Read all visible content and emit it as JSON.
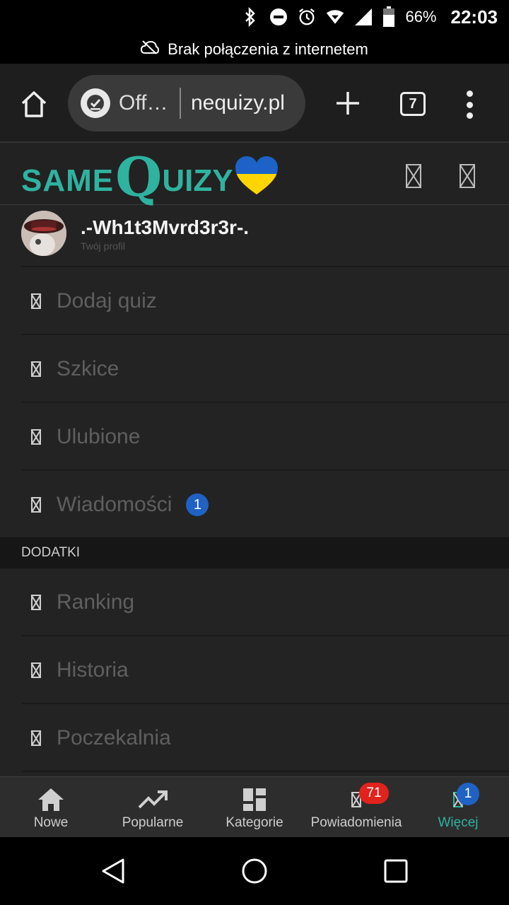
{
  "status_bar": {
    "battery_percent": "66%",
    "time": "22:03",
    "icons": [
      "bluetooth-icon",
      "do-not-disturb-icon",
      "alarm-icon",
      "wifi-icon",
      "cellular-signal-icon",
      "battery-icon"
    ]
  },
  "offline_banner": {
    "text": "Brak połączenia z internetem",
    "icon": "cloud-off-icon"
  },
  "browser": {
    "omnibox_status": "Off…",
    "url": "nequizy.pl",
    "tab_count": "7",
    "icons": [
      "home-icon",
      "offline-check-icon",
      "new-tab-plus-icon",
      "tabs-icon",
      "more-vert-icon"
    ]
  },
  "site": {
    "logo": {
      "same": "SAME",
      "q": "Q",
      "uizy": "UIZY"
    },
    "accent_color": "#2fb3a0"
  },
  "profile": {
    "name": ".-Wh1t3Mvrd3r3r-.",
    "subtitle": "Twój profil"
  },
  "menu": {
    "items": [
      {
        "label": "Dodaj quiz"
      },
      {
        "label": "Szkice"
      },
      {
        "label": "Ulubione"
      },
      {
        "label": "Wiadomości",
        "badge": "1"
      }
    ],
    "section_title": "DODATKI",
    "extra_items": [
      {
        "label": "Ranking"
      },
      {
        "label": "Historia"
      },
      {
        "label": "Poczekalnia"
      }
    ]
  },
  "bottom_nav": {
    "items": [
      {
        "label": "Nowe",
        "icon": "home-icon"
      },
      {
        "label": "Popularne",
        "icon": "trending-up-icon"
      },
      {
        "label": "Kategorie",
        "icon": "dashboard-icon"
      },
      {
        "label": "Powiadomienia",
        "icon": "bell-icon",
        "badge": "71"
      },
      {
        "label": "Więcej",
        "icon": "more-icon",
        "badge": "1",
        "active": true
      }
    ]
  }
}
